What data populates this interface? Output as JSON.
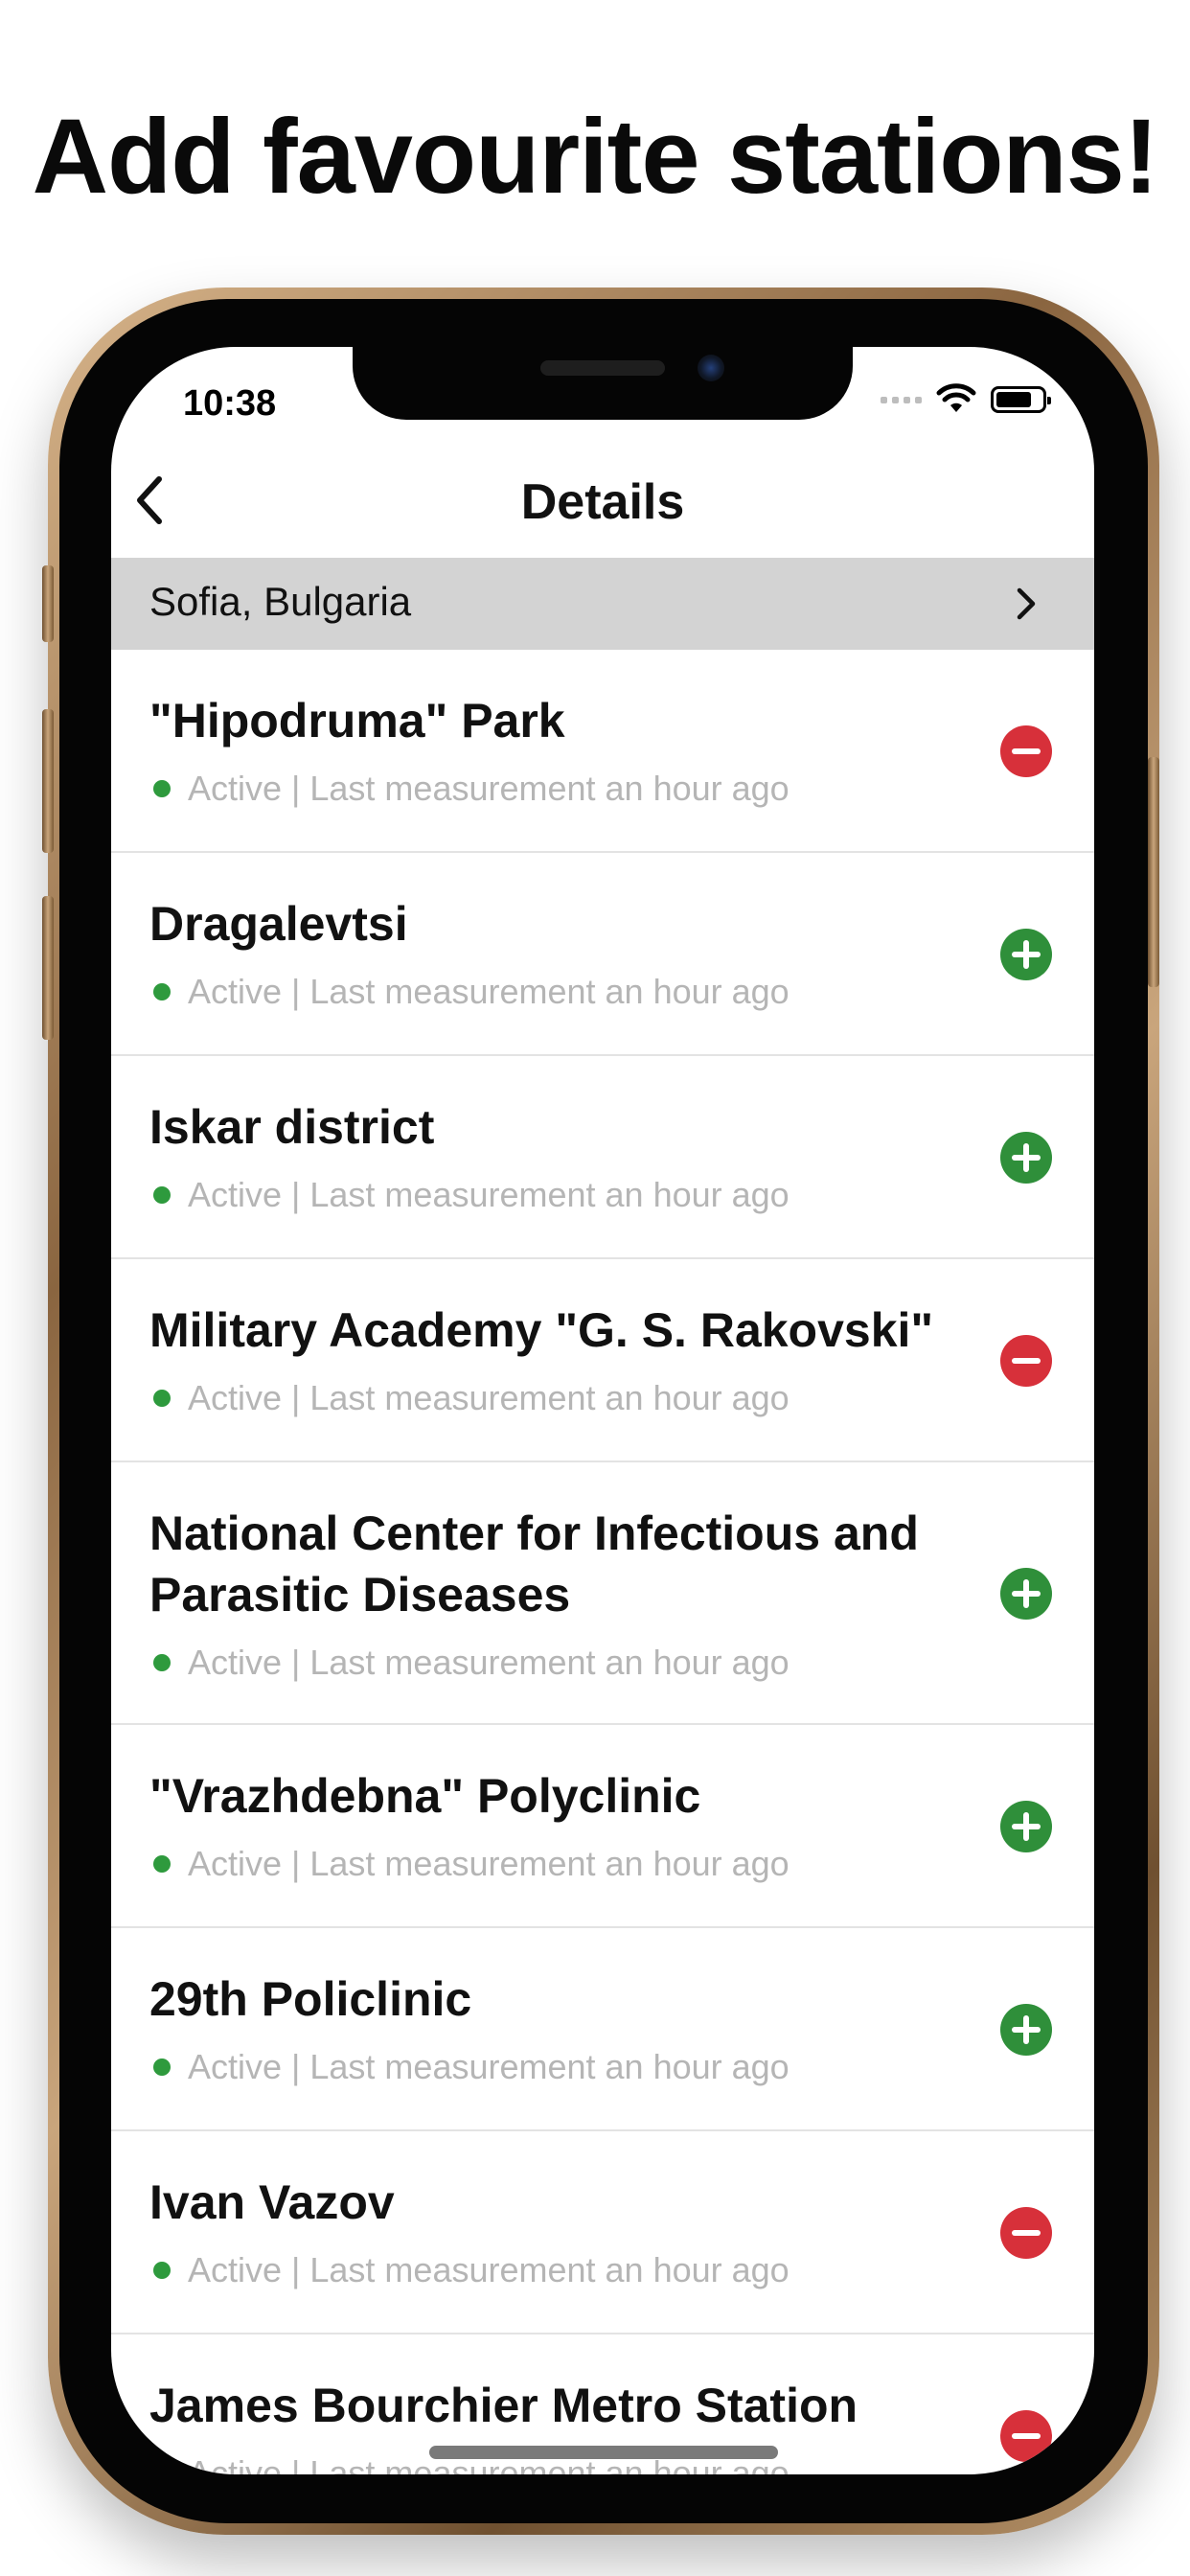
{
  "headline": "Add favourite stations!",
  "status_bar": {
    "time": "10:38"
  },
  "navbar": {
    "title": "Details"
  },
  "location": {
    "label": "Sofia, Bulgaria"
  },
  "stations": [
    {
      "name": "\"Hipodruma\" Park",
      "status": "Active | Last measurement an hour ago",
      "action": "remove"
    },
    {
      "name": "Dragalevtsi",
      "status": "Active | Last measurement an hour ago",
      "action": "add"
    },
    {
      "name": "Iskar district",
      "status": "Active | Last measurement an hour ago",
      "action": "add"
    },
    {
      "name": "Military Academy \"G. S. Rakovski\"",
      "status": "Active | Last measurement an hour ago",
      "action": "remove"
    },
    {
      "name": "National Center for Infectious and Parasitic Diseases",
      "status": "Active | Last measurement an hour ago",
      "action": "add"
    },
    {
      "name": "\"Vrazhdebna\" Polyclinic",
      "status": "Active | Last measurement an hour ago",
      "action": "add"
    },
    {
      "name": "29th Policlinic",
      "status": "Active | Last measurement an hour ago",
      "action": "add"
    },
    {
      "name": "Ivan Vazov",
      "status": "Active | Last measurement an hour ago",
      "action": "remove"
    },
    {
      "name": "James Bourchier Metro Station",
      "status": "Active | Last measurement an hour ago",
      "action": "remove"
    }
  ],
  "colors": {
    "add": "#2f8f3a",
    "remove": "#d7303a",
    "status_dot": "#2e9a3d",
    "location_bar": "#d3d3d3"
  }
}
